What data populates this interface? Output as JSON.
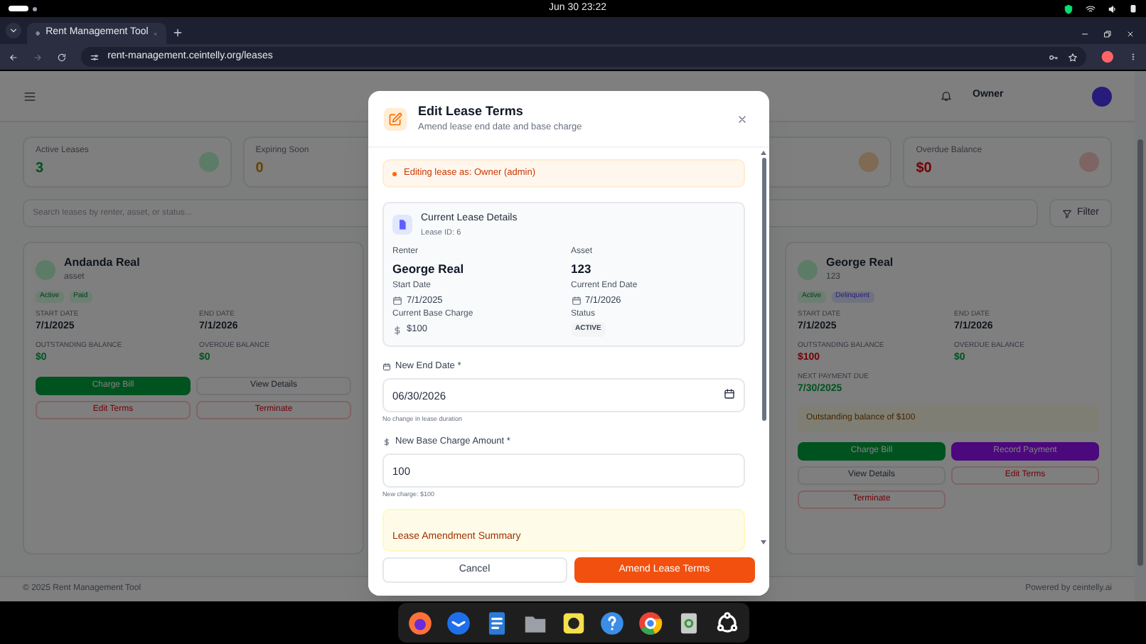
{
  "system_bar": {
    "clock": "Jun 30  23:22"
  },
  "browser": {
    "tabs": [
      {
        "title": "Rent Management Tool",
        "selected": true
      }
    ],
    "url": "rent-management.ceintelly.org/leases"
  },
  "page": {
    "user": {
      "name": "Owner"
    },
    "stats": [
      {
        "label": "Active Leases",
        "value": "3",
        "kind": "positive"
      },
      {
        "label": "Expiring Soon",
        "value": "0",
        "kind": "warning"
      },
      {
        "label": "Overdue Balance",
        "value": "$0",
        "kind": "danger"
      }
    ],
    "search": {
      "placeholder": "Search leases by renter, asset, or status...",
      "filter": "Filter"
    },
    "leases": [
      {
        "name": "Andanda Real",
        "asset": "asset",
        "badges": [
          {
            "label": "Active",
            "kind": "success"
          },
          {
            "label": "Paid",
            "kind": "success"
          }
        ],
        "fields": [
          {
            "label": "START DATE",
            "value": "7/1/2025"
          },
          {
            "label": "END DATE",
            "value": "7/1/2026"
          },
          {
            "label": "OUTSTANDING BALANCE",
            "value": "$0",
            "alert": false
          },
          {
            "label": "OVERDUE BALANCE",
            "value": "$0",
            "alert": false
          }
        ],
        "buttons": [
          {
            "label": "Charge Bill",
            "kind": "green"
          },
          {
            "label": "View Details",
            "kind": "plain"
          },
          {
            "label": "Edit Terms",
            "kind": "outline"
          },
          {
            "label": "Terminate",
            "kind": "outline"
          }
        ]
      },
      {
        "name": "George Real",
        "asset": "123",
        "badges": [
          {
            "label": "Active",
            "kind": "success"
          },
          {
            "label": "Delinquent",
            "kind": "info"
          }
        ],
        "fields": [
          {
            "label": "START DATE",
            "value": "7/1/2025"
          },
          {
            "label": "END DATE",
            "value": "7/1/2026"
          },
          {
            "label": "OUTSTANDING BALANCE",
            "value": "$100",
            "alert": true
          },
          {
            "label": "OVERDUE BALANCE",
            "value": "$0",
            "alert": false
          },
          {
            "label": "NEXT PAYMENT DUE",
            "value": "7/30/2025",
            "alert": false
          }
        ],
        "warning": "Outstanding balance of $100",
        "buttons": [
          {
            "label": "Charge Bill",
            "kind": "green"
          },
          {
            "label": "Record Payment",
            "kind": "purple"
          },
          {
            "label": "View Details",
            "kind": "plain"
          },
          {
            "label": "Edit Terms",
            "kind": "outline"
          },
          {
            "label": "Terminate",
            "kind": "outline"
          }
        ]
      }
    ],
    "footer_left": "© 2025 Rent Management Tool",
    "footer_right": "Powered by ceintelly.ai"
  },
  "modal": {
    "title": "Edit Lease Terms",
    "subtitle": "Amend lease end date and base charge",
    "notice": "Editing lease as: Owner (admin)",
    "details": {
      "title": "Current Lease Details",
      "lease_id": "Lease ID: 6",
      "fields": [
        {
          "label": "Renter",
          "value": "George Real",
          "kind": "big"
        },
        {
          "label": "Asset",
          "value": "123",
          "kind": "big"
        },
        {
          "label": "Start Date",
          "value": "7/1/2025",
          "kind": "date"
        },
        {
          "label": "Current End Date",
          "value": "7/1/2026",
          "kind": "date"
        },
        {
          "label": "Current Base Charge",
          "value": "$100",
          "kind": "money"
        },
        {
          "label": "Status",
          "value": "ACTIVE",
          "kind": "badge"
        }
      ]
    },
    "inputs": [
      {
        "label": "New End Date *",
        "value": "06/30/2026",
        "hint": "No change in lease duration",
        "kind": "date"
      },
      {
        "label": "New Base Charge Amount *",
        "value": "100",
        "hint": "New charge: $100",
        "kind": "money"
      }
    ],
    "summary": {
      "title": "Lease Amendment Summary"
    },
    "buttons": [
      {
        "label": "Cancel",
        "kind": "secondary"
      },
      {
        "label": "Amend Lease Terms",
        "kind": "primary"
      }
    ]
  }
}
